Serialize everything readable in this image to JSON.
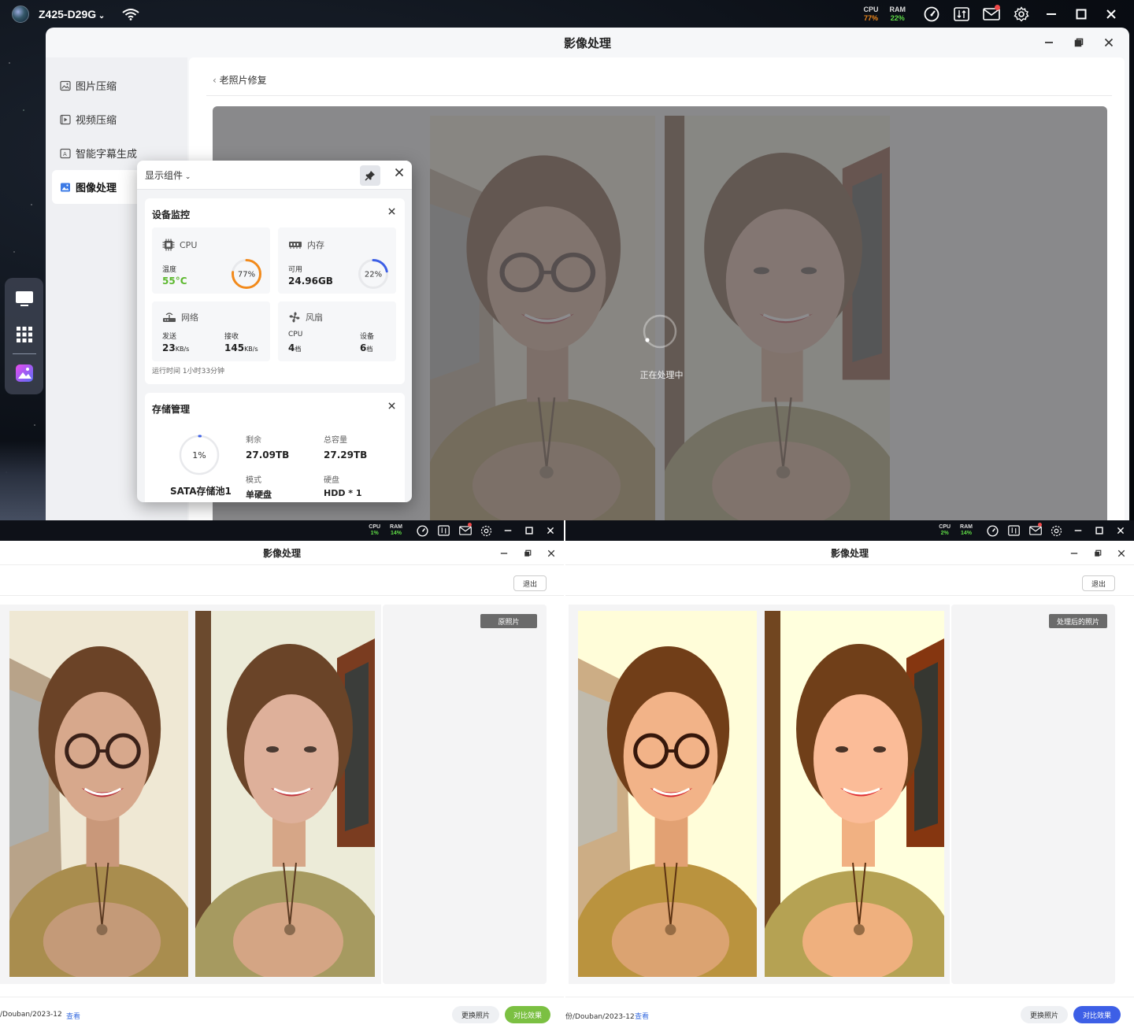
{
  "taskbar": {
    "device_name": "Z425-D29G",
    "cpu_label": "CPU",
    "cpu_value": "77%",
    "ram_label": "RAM",
    "ram_value": "22%"
  },
  "window": {
    "title": "影像处理",
    "sidebar": [
      {
        "label": "图片压缩"
      },
      {
        "label": "视频压缩"
      },
      {
        "label": "智能字幕生成"
      },
      {
        "label": "图像处理"
      }
    ],
    "breadcrumb": "老照片修复",
    "processing_text": "正在处理中"
  },
  "widget_panel": {
    "dropdown_label": "显示组件",
    "device_monitor": {
      "title": "设备监控",
      "cpu": {
        "label": "CPU",
        "temp_label": "温度",
        "temp_value": "55°C",
        "usage_label": "77%",
        "usage": 0.77
      },
      "memory": {
        "label": "内存",
        "avail_label": "可用",
        "avail_value": "24.96GB",
        "usage_label": "22%",
        "usage": 0.22
      },
      "network": {
        "label": "网络",
        "send_label": "发送",
        "send_value": "23",
        "send_unit": "KB/s",
        "recv_label": "接收",
        "recv_value": "145",
        "recv_unit": "KB/s"
      },
      "fan": {
        "label": "风扇",
        "cpu_label": "CPU",
        "cpu_value": "4",
        "cpu_unit": "档",
        "device_label": "设备",
        "device_value": "6",
        "device_unit": "档"
      },
      "uptime": "运行时间 1小时33分钟"
    },
    "storage": {
      "title": "存储管理",
      "pool_name": "SATA存储池1",
      "usage_label": "1%",
      "usage": 0.01,
      "remaining_label": "剩余",
      "remaining_value": "27.09TB",
      "total_label": "总容量",
      "total_value": "27.29TB",
      "mode_label": "模式",
      "mode_value": "单硬盘",
      "disk_label": "硬盘",
      "disk_value": "HDD * 1"
    }
  },
  "panel_left": {
    "cpu_label": "CPU",
    "cpu_value": "1%",
    "ram_label": "RAM",
    "ram_value": "14%",
    "title": "影像处理",
    "exit_label": "退出",
    "tag": "原照片",
    "path": "/Douban/2023-12",
    "view_link": "查看",
    "change_btn": "更换照片",
    "compare_btn": "对比效果"
  },
  "panel_right": {
    "cpu_label": "CPU",
    "cpu_value": "2%",
    "ram_label": "RAM",
    "ram_value": "14%",
    "title": "影像处理",
    "exit_label": "退出",
    "tag": "处理后的照片",
    "path": "份/Douban/2023-12",
    "view_link": "查看",
    "change_btn": "更换照片",
    "compare_btn": "对比效果"
  },
  "colors": {
    "cpu_value": "#f28a1b",
    "ram_value": "#5fdc46",
    "accent_blue": "#3d5fe6",
    "accent_green": "#7bc042",
    "temp_green": "#5cb82e"
  }
}
